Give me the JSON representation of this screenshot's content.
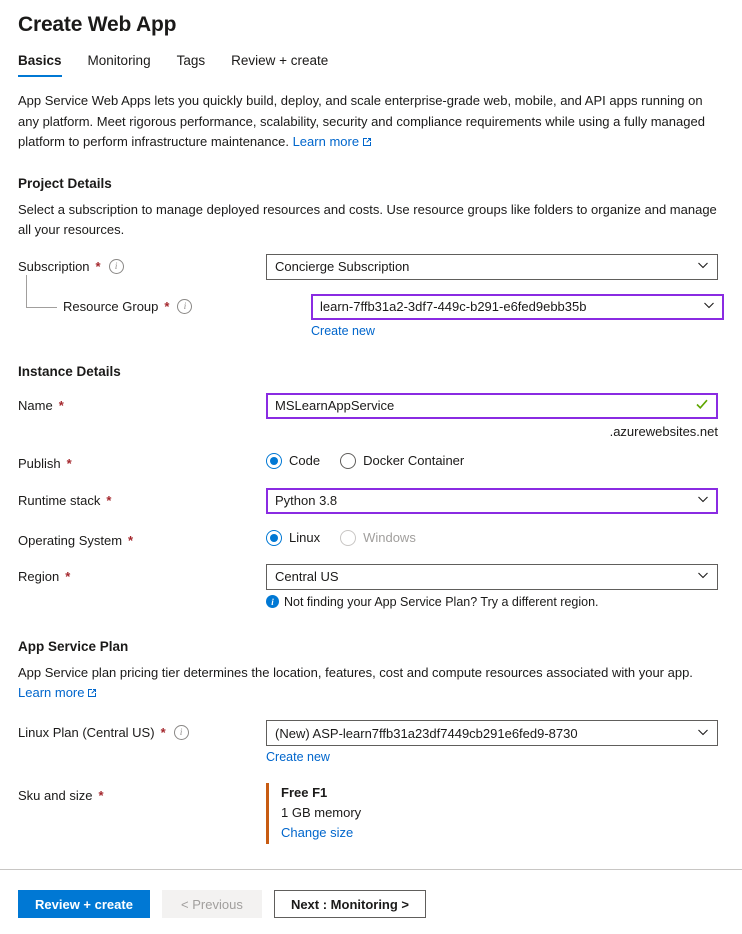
{
  "page": {
    "title": "Create Web App"
  },
  "tabs": [
    {
      "label": "Basics",
      "active": true
    },
    {
      "label": "Monitoring",
      "active": false
    },
    {
      "label": "Tags",
      "active": false
    },
    {
      "label": "Review + create",
      "active": false
    }
  ],
  "intro": {
    "text": "App Service Web Apps lets you quickly build, deploy, and scale enterprise-grade web, mobile, and API apps running on any platform. Meet rigorous performance, scalability, security and compliance requirements while using a fully managed platform to perform infrastructure maintenance.",
    "learn_more": "Learn more"
  },
  "project_details": {
    "heading": "Project Details",
    "description": "Select a subscription to manage deployed resources and costs. Use resource groups like folders to organize and manage all your resources.",
    "subscription": {
      "label": "Subscription",
      "required": "*",
      "value": "Concierge Subscription"
    },
    "resource_group": {
      "label": "Resource Group",
      "required": "*",
      "value": "learn-7ffb31a2-3df7-449c-b291-e6fed9ebb35b",
      "create_new": "Create new"
    }
  },
  "instance_details": {
    "heading": "Instance Details",
    "name": {
      "label": "Name",
      "required": "*",
      "value": "MSLearnAppService",
      "suffix": ".azurewebsites.net"
    },
    "publish": {
      "label": "Publish",
      "required": "*",
      "options": [
        {
          "label": "Code",
          "selected": true,
          "disabled": false
        },
        {
          "label": "Docker Container",
          "selected": false,
          "disabled": false
        }
      ]
    },
    "runtime_stack": {
      "label": "Runtime stack",
      "required": "*",
      "value": "Python 3.8"
    },
    "operating_system": {
      "label": "Operating System",
      "required": "*",
      "options": [
        {
          "label": "Linux",
          "selected": true,
          "disabled": false
        },
        {
          "label": "Windows",
          "selected": false,
          "disabled": true
        }
      ]
    },
    "region": {
      "label": "Region",
      "required": "*",
      "value": "Central US",
      "hint": "Not finding your App Service Plan? Try a different region."
    }
  },
  "app_service_plan": {
    "heading": "App Service Plan",
    "description": "App Service plan pricing tier determines the location, features, cost and compute resources associated with your app.",
    "learn_more": "Learn more",
    "linux_plan": {
      "label": "Linux Plan (Central US)",
      "required": "*",
      "value": "(New) ASP-learn7ffb31a23df7449cb291e6fed9-8730",
      "create_new": "Create new"
    },
    "sku": {
      "label": "Sku and size",
      "required": "*",
      "tier": "Free F1",
      "memory": "1 GB memory",
      "change_size": "Change size"
    }
  },
  "footer": {
    "review_create": "Review + create",
    "previous": "< Previous",
    "next": "Next : Monitoring >"
  },
  "colors": {
    "accent_blue": "#0078d4",
    "link_blue": "#0066cc",
    "focus_purple": "#8a2be2",
    "required_red": "#a4262c",
    "sku_accent": "#c75b12",
    "valid_green": "#5ea600"
  },
  "icons": {
    "chevron_down": "chevron-down-icon",
    "external_link": "external-link-icon",
    "info": "info-icon",
    "check": "check-icon"
  }
}
